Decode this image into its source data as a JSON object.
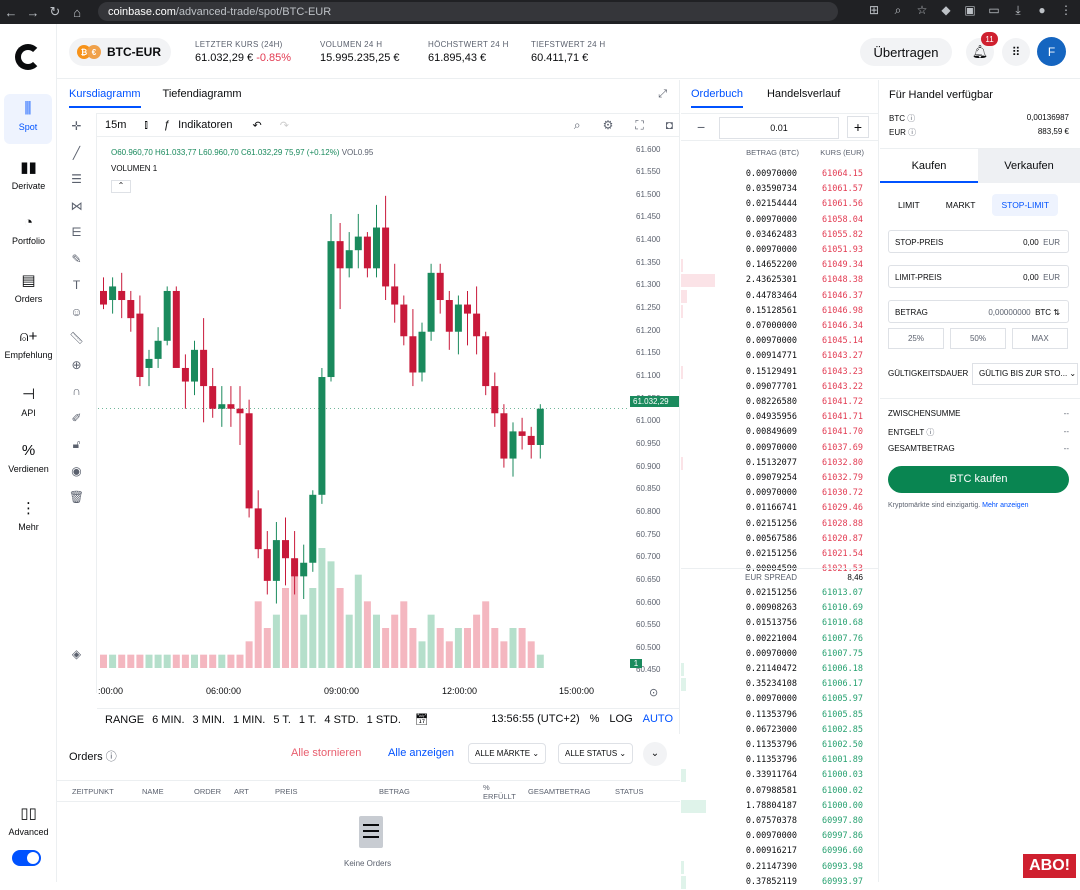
{
  "browser": {
    "url_host": "coinbase.com",
    "url_path": "/advanced-trade/spot/BTC-EUR"
  },
  "rail": {
    "items": [
      {
        "label": "Spot"
      },
      {
        "label": "Derivate"
      },
      {
        "label": "Portfolio"
      },
      {
        "label": "Orders"
      },
      {
        "label": "Empfehlung"
      },
      {
        "label": "API"
      },
      {
        "label": "Verdienen"
      },
      {
        "label": "Mehr"
      }
    ],
    "bottom_label": "Advanced"
  },
  "header": {
    "pair": "BTC-EUR",
    "stats": [
      {
        "label": "LETZTER KURS (24H)",
        "value": "61.032,29 €",
        "change": "-0.85%"
      },
      {
        "label": "VOLUMEN 24 H",
        "value": "15.995.235,25 €"
      },
      {
        "label": "HÖCHSTWERT 24 H",
        "value": "61.895,43 €"
      },
      {
        "label": "TIEFSTWERT 24 H",
        "value": "60.411,71 €"
      }
    ],
    "transfer_label": "Übertragen",
    "notif_count": "11",
    "avatar": "F"
  },
  "chart": {
    "tabs": [
      "Kursdiagramm",
      "Tiefendiagramm"
    ],
    "interval": "15m",
    "indicators_label": "Indikatoren",
    "legend": {
      "o": "O60.960,70",
      "h": "H61.033,77",
      "l": "L60.960,70",
      "c": "C61.032,29",
      "chg": "75,97 (+0.12%)",
      "vol": "VOL0.95"
    },
    "volume_label": "VOLUMEN  1",
    "price_tag": "61.032,29",
    "vol_tag": "1",
    "range_items": [
      "RANGE",
      "6 MIN.",
      "3 MIN.",
      "1 MIN.",
      "5 T.",
      "1 T.",
      "4 STD.",
      "1 STD."
    ],
    "clock": "13:56:55 (UTC+2)",
    "scale_opts": [
      "%",
      "LOG",
      "AUTO"
    ]
  },
  "chart_data": {
    "type": "candlestick",
    "y_ticks": [
      "61.600",
      "61.550",
      "61.500",
      "61.450",
      "61.400",
      "61.350",
      "61.300",
      "61.250",
      "61.200",
      "61.150",
      "61.100",
      "61.050",
      "61.000",
      "60.950",
      "60.900",
      "60.850",
      "60.800",
      "60.750",
      "60.700",
      "60.650",
      "60.600",
      "60.550",
      "60.500",
      "60.450"
    ],
    "x_ticks": [
      ":00:00",
      "06:00:00",
      "09:00:00",
      "12:00:00",
      "15:00:00"
    ],
    "ylim": [
      60440,
      61610
    ],
    "candles": [
      [
        61290,
        61320,
        61250,
        61260
      ],
      [
        61270,
        61320,
        61240,
        61300
      ],
      [
        61290,
        61330,
        61230,
        61270
      ],
      [
        61270,
        61290,
        61200,
        61230
      ],
      [
        61240,
        61280,
        61080,
        61100
      ],
      [
        61120,
        61160,
        61080,
        61140
      ],
      [
        61140,
        61210,
        61120,
        61180
      ],
      [
        61180,
        61300,
        61170,
        61290
      ],
      [
        61290,
        61300,
        61160,
        61120
      ],
      [
        61120,
        61150,
        61030,
        61090
      ],
      [
        61090,
        61180,
        61060,
        61160
      ],
      [
        61160,
        61230,
        61000,
        61080
      ],
      [
        61080,
        61120,
        61010,
        61030
      ],
      [
        61030,
        61080,
        60990,
        61040
      ],
      [
        61040,
        61080,
        60990,
        61030
      ],
      [
        61030,
        61080,
        60950,
        61020
      ],
      [
        61020,
        61050,
        60790,
        60810
      ],
      [
        60810,
        60850,
        60700,
        60720
      ],
      [
        60720,
        60760,
        60620,
        60650
      ],
      [
        60650,
        60780,
        60600,
        60740
      ],
      [
        60740,
        60790,
        60640,
        60700
      ],
      [
        60700,
        60760,
        60620,
        60660
      ],
      [
        60660,
        60730,
        60610,
        60690
      ],
      [
        60690,
        60850,
        60670,
        60840
      ],
      [
        60840,
        61120,
        60820,
        61100
      ],
      [
        61100,
        61460,
        61090,
        61400
      ],
      [
        61400,
        61440,
        61250,
        61340
      ],
      [
        61340,
        61420,
        61320,
        61380
      ],
      [
        61380,
        61460,
        61340,
        61410
      ],
      [
        61410,
        61420,
        61320,
        61340
      ],
      [
        61340,
        61480,
        61320,
        61430
      ],
      [
        61430,
        61500,
        61270,
        61300
      ],
      [
        61300,
        61350,
        61220,
        61260
      ],
      [
        61260,
        61280,
        61170,
        61190
      ],
      [
        61190,
        61250,
        61080,
        61110
      ],
      [
        61110,
        61220,
        61090,
        61200
      ],
      [
        61200,
        61350,
        61180,
        61330
      ],
      [
        61330,
        61350,
        61240,
        61270
      ],
      [
        61270,
        61290,
        61160,
        61200
      ],
      [
        61200,
        61280,
        61150,
        61260
      ],
      [
        61260,
        61290,
        61170,
        61240
      ],
      [
        61240,
        61300,
        61150,
        61190
      ],
      [
        61190,
        61200,
        61060,
        61080
      ],
      [
        61080,
        61110,
        60990,
        61020
      ],
      [
        61020,
        61040,
        60900,
        60920
      ],
      [
        60920,
        61000,
        60880,
        60980
      ],
      [
        60980,
        61010,
        60940,
        60970
      ],
      [
        60970,
        60990,
        60920,
        60950
      ],
      [
        60950,
        61040,
        60920,
        61030
      ]
    ],
    "volumes": [
      1,
      1,
      1,
      1,
      1,
      1,
      1,
      1,
      1,
      1,
      1,
      1,
      1,
      1,
      1,
      1,
      2,
      5,
      3,
      4,
      6,
      7,
      4,
      6,
      9,
      8,
      6,
      4,
      7,
      5,
      4,
      3,
      4,
      5,
      3,
      2,
      4,
      3,
      2,
      3,
      3,
      4,
      5,
      3,
      2,
      3,
      3,
      2,
      1
    ]
  },
  "orders": {
    "title": "Orders",
    "cancel_all": "Alle stornieren",
    "show_all": "Alle anzeigen",
    "markets_sel": "ALLE MÄRKTE",
    "status_sel": "ALLE STATUS",
    "cols": [
      "ZEITPUNKT",
      "NAME",
      "ORDER",
      "ART",
      "PREIS",
      "BETRAG",
      "% ERFÜLLT",
      "GESAMTBETRAG",
      "STATUS"
    ],
    "empty": "Keine Orders"
  },
  "orderbook": {
    "tabs": [
      "Orderbuch",
      "Handelsverlauf"
    ],
    "step": "0.01",
    "col_amount": "BETRAG (BTC)",
    "col_price": "KURS (EUR)",
    "spread_label": "EUR SPREAD",
    "spread_value": "8,46",
    "asks": [
      [
        "0.00970000",
        "61064.15"
      ],
      [
        "0.03590734",
        "61061.57"
      ],
      [
        "0.02154444",
        "61061.56"
      ],
      [
        "0.00970000",
        "61058.04"
      ],
      [
        "0.03462483",
        "61055.82"
      ],
      [
        "0.00970000",
        "61051.93"
      ],
      [
        "0.14652200",
        "61049.34"
      ],
      [
        "2.43625301",
        "61048.38"
      ],
      [
        "0.44783464",
        "61046.37"
      ],
      [
        "0.15128561",
        "61046.98"
      ],
      [
        "0.07000000",
        "61046.34"
      ],
      [
        "0.00970000",
        "61045.14"
      ],
      [
        "0.00914771",
        "61043.27"
      ],
      [
        "0.15129491",
        "61043.23"
      ],
      [
        "0.09077701",
        "61043.22"
      ],
      [
        "0.08226580",
        "61041.72"
      ],
      [
        "0.04935956",
        "61041.71"
      ],
      [
        "0.00849609",
        "61041.70"
      ],
      [
        "0.00970000",
        "61037.69"
      ],
      [
        "0.15132077",
        "61032.80"
      ],
      [
        "0.09079254",
        "61032.79"
      ],
      [
        "0.00970000",
        "61030.72"
      ],
      [
        "0.01166741",
        "61029.46"
      ],
      [
        "0.02151256",
        "61028.88"
      ],
      [
        "0.00567586",
        "61020.87"
      ],
      [
        "0.02151256",
        "61021.54"
      ],
      [
        "0.00004590",
        "61021.53"
      ]
    ],
    "bids": [
      [
        "0.02151256",
        "61013.07"
      ],
      [
        "0.00908263",
        "61010.69"
      ],
      [
        "0.01513756",
        "61010.68"
      ],
      [
        "0.00221004",
        "61007.76"
      ],
      [
        "0.00970000",
        "61007.75"
      ],
      [
        "0.21140472",
        "61006.18"
      ],
      [
        "0.35234108",
        "61006.17"
      ],
      [
        "0.00970000",
        "61005.97"
      ],
      [
        "0.11353796",
        "61005.85"
      ],
      [
        "0.06723000",
        "61002.85"
      ],
      [
        "0.11353796",
        "61002.50"
      ],
      [
        "0.11353796",
        "61001.89"
      ],
      [
        "0.33911764",
        "61000.03"
      ],
      [
        "0.07988581",
        "61000.02"
      ],
      [
        "1.78804187",
        "61000.00"
      ],
      [
        "0.07570378",
        "60997.80"
      ],
      [
        "0.00970000",
        "60997.86"
      ],
      [
        "0.00916217",
        "60996.60"
      ],
      [
        "0.21147390",
        "60993.98"
      ],
      [
        "0.37852119",
        "60993.97"
      ]
    ]
  },
  "trade": {
    "title": "Für Handel verfügbar",
    "btc_label": "BTC",
    "btc_value": "0,00136987",
    "eur_label": "EUR",
    "eur_value": "883,59 €",
    "buy_tab": "Kaufen",
    "sell_tab": "Verkaufen",
    "types": [
      "LIMIT",
      "MARKT",
      "STOP-LIMIT"
    ],
    "stop_label": "STOP-PREIS",
    "stop_value": "0,00",
    "stop_unit": "EUR",
    "limit_label": "LIMIT-PREIS",
    "limit_value": "0,00",
    "limit_unit": "EUR",
    "amount_label": "BETRAG",
    "amount_value": "0,00000000",
    "amount_unit": "BTC ⇅",
    "pcts": [
      "25%",
      "50%",
      "MAX"
    ],
    "validity_label": "GÜLTIGKEITSDAUER",
    "validity_value": "GÜLTIG BIS ZUR STO...",
    "subtotal": "ZWISCHENSUMME",
    "fee": "ENTGELT",
    "total": "GESAMTBETRAG",
    "dash": "--",
    "buy_button": "BTC kaufen",
    "note": "Kryptomärkte sind einzigartig.",
    "note_link": "Mehr anzeigen"
  },
  "watermark": "ABO!"
}
